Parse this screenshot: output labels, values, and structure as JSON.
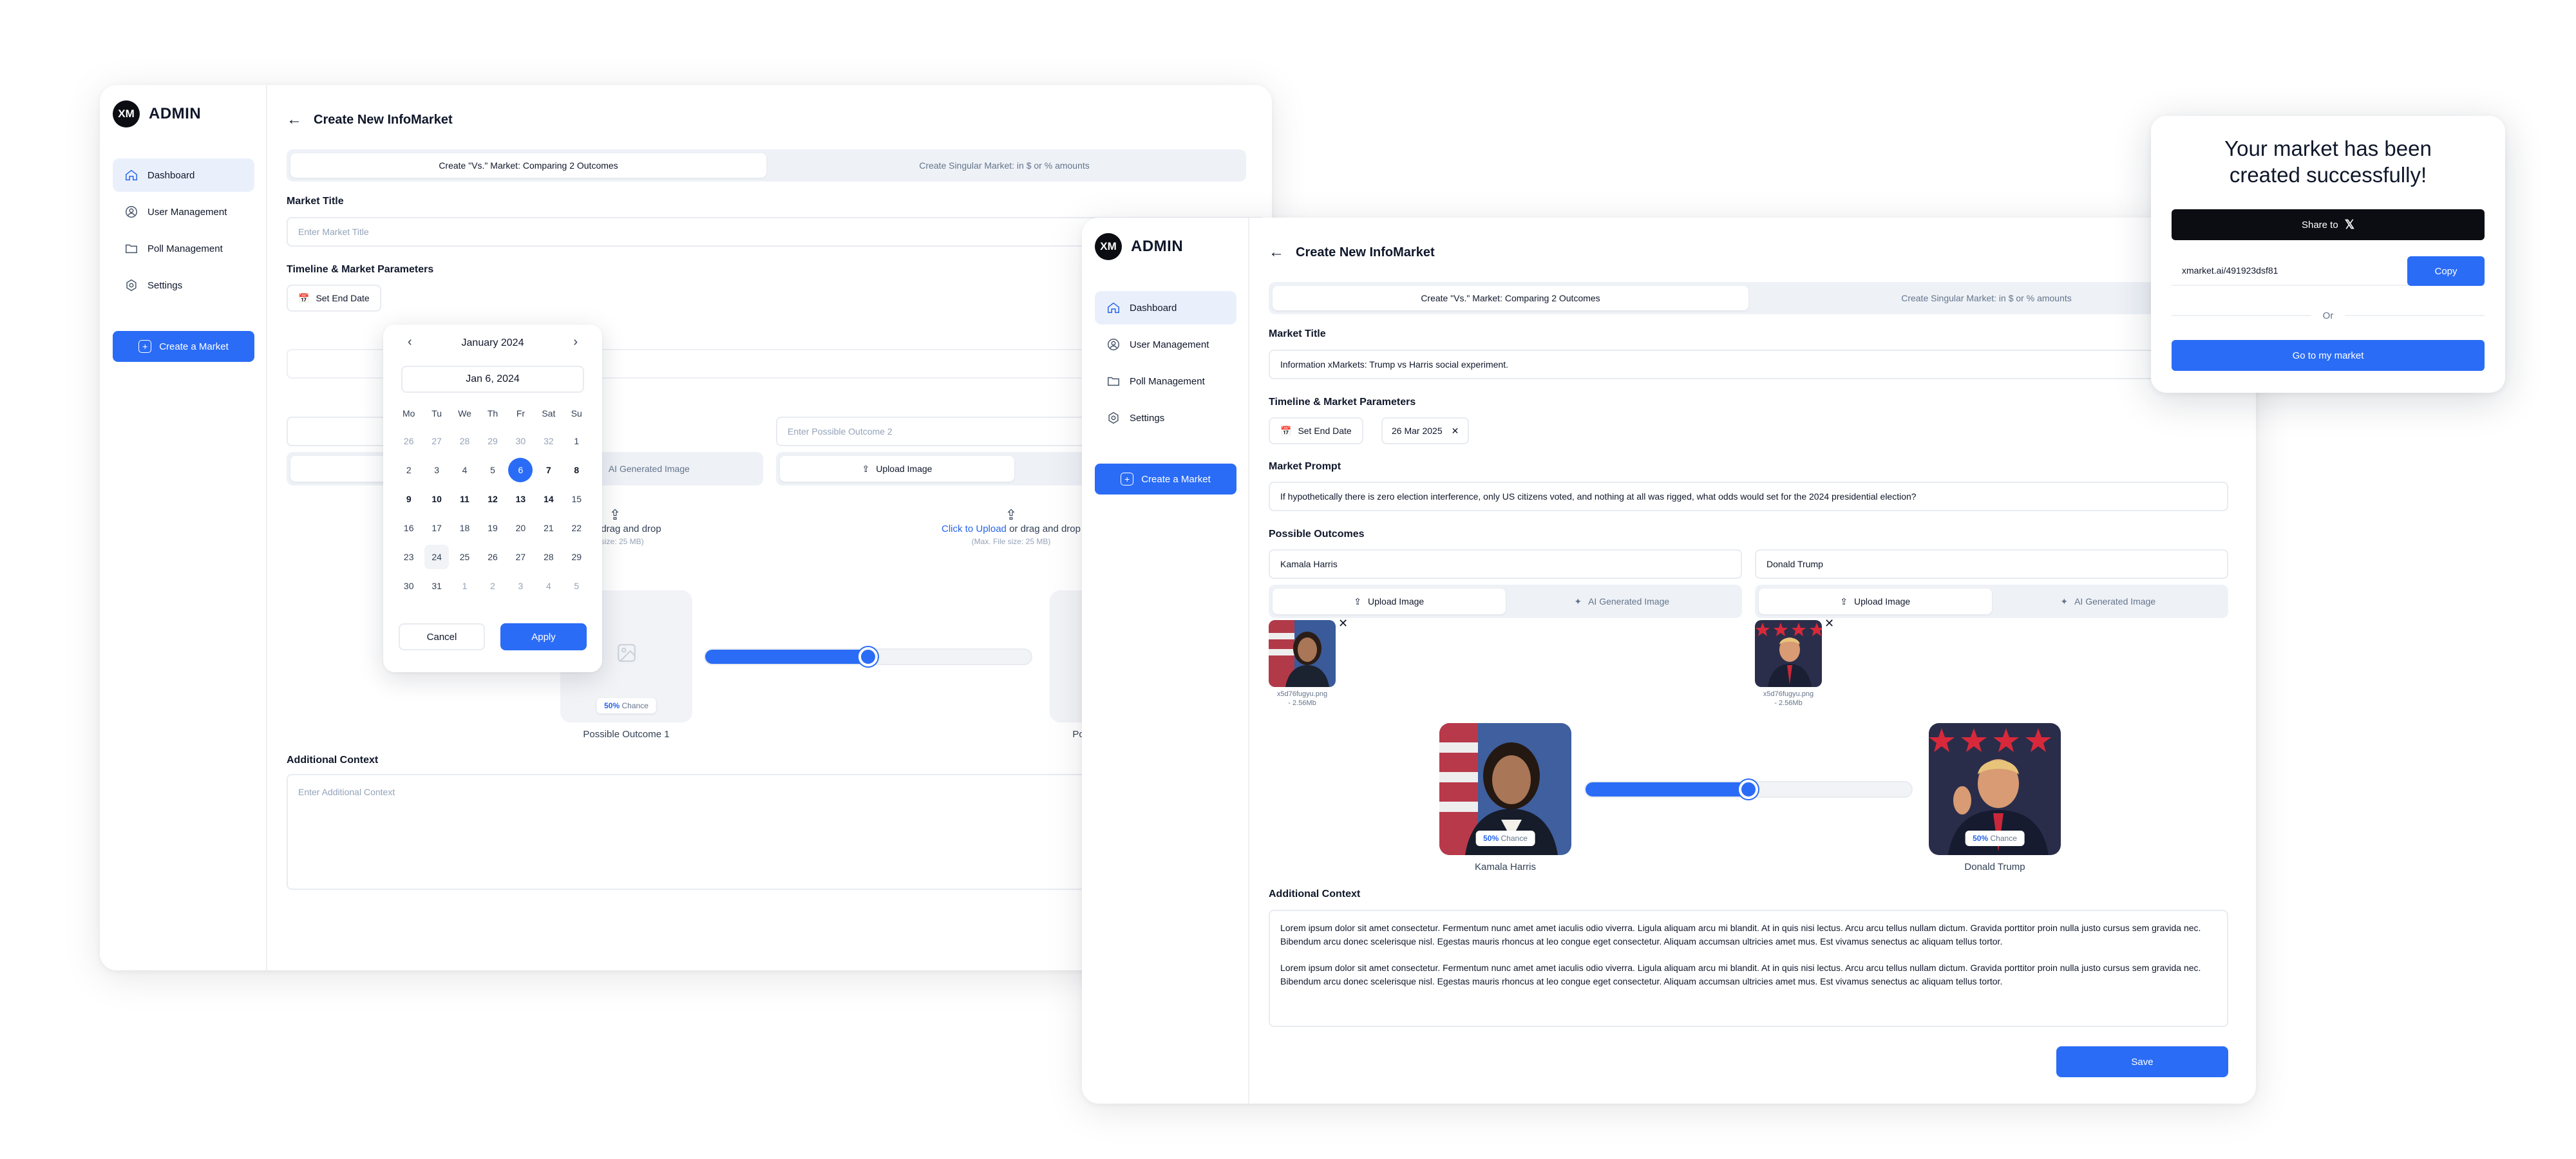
{
  "brand": {
    "logo_text": "XM",
    "name": "ADMIN"
  },
  "sidebar": {
    "items": [
      {
        "label": "Dashboard",
        "icon": "home-icon"
      },
      {
        "label": "User Management",
        "icon": "user-icon"
      },
      {
        "label": "Poll Management",
        "icon": "folder-icon"
      },
      {
        "label": "Settings",
        "icon": "gear-icon"
      }
    ],
    "create_button": "Create a Market"
  },
  "page": {
    "title": "Create New InfoMarket",
    "tabs": [
      "Create \"Vs.\" Market: Comparing 2 Outcomes",
      "Create Singular Market: in $ or % amounts"
    ]
  },
  "left_form": {
    "market_title_label": "Market Title",
    "market_title_placeholder": "Enter Market Title",
    "timeline_label": "Timeline & Market Parameters",
    "set_end_date": "Set End Date",
    "outcome2_placeholder": "Enter Possible Outcome 2",
    "ai_generated": "AI Generated Image",
    "upload_image": "Upload Image",
    "upload_link": "Click to Upload",
    "upload_link_partial": "load",
    "upload_rest": " or drag and drop",
    "upload_sub": "(Max. File size: 25 MB)",
    "upload_sub_partial": "File size: 25 MB)",
    "chance": "50%",
    "chance_word": "Chance",
    "outcome1_caption": "Possible Outcome 1",
    "outcome2_caption": "Possible Outcome 2",
    "slider_value": 0.5,
    "additional_context_label": "Additional Context",
    "additional_context_placeholder": "Enter Additional Context"
  },
  "calendar": {
    "month": "January 2024",
    "selected_text": "Jan 6, 2024",
    "weekdays": [
      "Mo",
      "Tu",
      "We",
      "Th",
      "Fr",
      "Sat",
      "Su"
    ],
    "days": [
      {
        "d": "26",
        "t": "out"
      },
      {
        "d": "27",
        "t": "out"
      },
      {
        "d": "28",
        "t": "out"
      },
      {
        "d": "29",
        "t": "out"
      },
      {
        "d": "30",
        "t": "out"
      },
      {
        "d": "32",
        "t": "out"
      },
      {
        "d": "1",
        "t": ""
      },
      {
        "d": "2",
        "t": ""
      },
      {
        "d": "3",
        "t": ""
      },
      {
        "d": "4",
        "t": ""
      },
      {
        "d": "5",
        "t": ""
      },
      {
        "d": "6",
        "t": "sel"
      },
      {
        "d": "7",
        "t": "bold"
      },
      {
        "d": "8",
        "t": "bold"
      },
      {
        "d": "9",
        "t": "bold"
      },
      {
        "d": "10",
        "t": "bold"
      },
      {
        "d": "11",
        "t": "bold"
      },
      {
        "d": "12",
        "t": "bold"
      },
      {
        "d": "13",
        "t": "bold"
      },
      {
        "d": "14",
        "t": "bold"
      },
      {
        "d": "15",
        "t": ""
      },
      {
        "d": "16",
        "t": ""
      },
      {
        "d": "17",
        "t": ""
      },
      {
        "d": "18",
        "t": ""
      },
      {
        "d": "19",
        "t": ""
      },
      {
        "d": "20",
        "t": ""
      },
      {
        "d": "21",
        "t": ""
      },
      {
        "d": "22",
        "t": ""
      },
      {
        "d": "23",
        "t": ""
      },
      {
        "d": "24",
        "t": "today"
      },
      {
        "d": "25",
        "t": ""
      },
      {
        "d": "26",
        "t": ""
      },
      {
        "d": "27",
        "t": ""
      },
      {
        "d": "28",
        "t": ""
      },
      {
        "d": "29",
        "t": ""
      },
      {
        "d": "30",
        "t": ""
      },
      {
        "d": "31",
        "t": ""
      },
      {
        "d": "1",
        "t": "out"
      },
      {
        "d": "2",
        "t": "out"
      },
      {
        "d": "3",
        "t": "out"
      },
      {
        "d": "4",
        "t": "out"
      },
      {
        "d": "5",
        "t": "out"
      }
    ],
    "cancel": "Cancel",
    "apply": "Apply"
  },
  "right_form": {
    "market_title_label": "Market Title",
    "market_title_value": "Information xMarkets: Trump vs Harris social experiment.",
    "timeline_label": "Timeline & Market Parameters",
    "set_end_date": "Set End Date",
    "end_date_value": "26 Mar 2025",
    "prompt_label": "Market Prompt",
    "prompt_value": "If hypothetically there is zero election interference, only US citizens voted, and nothing at all was rigged, what odds would set for the 2024 presidential election?",
    "outcomes_label": "Possible Outcomes",
    "outcome1": "Kamala Harris",
    "outcome2": "Donald Trump",
    "upload_image": "Upload Image",
    "ai_generated": "AI Generated Image",
    "file1_name": "x5d76fugyu.png",
    "file2_name": "x5d76fugyu.png",
    "file_size": "- 2.56Mb",
    "chance": "50%",
    "chance_word": "Chance",
    "slider_value": 0.5,
    "caption1": "Kamala Harris",
    "caption2": "Donald Trump",
    "additional_context_label": "Additional Context",
    "context_p1": "Lorem ipsum dolor sit amet consectetur. Fermentum nunc amet amet iaculis odio viverra. Ligula aliquam arcu mi blandit. At in quis nisi lectus. Arcu arcu tellus nullam dictum. Gravida porttitor proin nulla justo cursus sem gravida nec. Bibendum arcu donec scelerisque nisl. Egestas mauris rhoncus at leo congue eget consectetur. Aliquam accumsan ultricies amet mus. Est vivamus senectus ac aliquam tellus tortor.",
    "context_p2": "Lorem ipsum dolor sit amet consectetur. Fermentum nunc amet amet iaculis odio viverra. Ligula aliquam arcu mi blandit. At in quis nisi lectus. Arcu arcu tellus nullam dictum. Gravida porttitor proin nulla justo cursus sem gravida nec. Bibendum arcu donec scelerisque nisl. Egestas mauris rhoncus at leo congue eget consectetur. Aliquam accumsan ultricies amet mus. Est vivamus senectus ac aliquam tellus tortor.",
    "save": "Save"
  },
  "popup": {
    "title_line1": "Your market has been",
    "title_line2": "created successfully!",
    "share": "Share to",
    "link": "xmarket.ai/491923dsf81",
    "copy": "Copy",
    "or": "Or",
    "goto": "Go to my market"
  },
  "colors": {
    "accent": "#2a6cf6",
    "dark": "#0b0d12",
    "border": "#e8ebf0"
  }
}
